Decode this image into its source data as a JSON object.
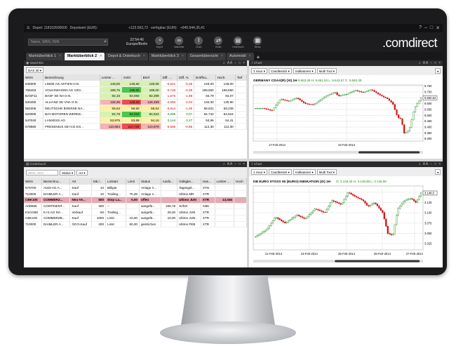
{
  "window": {
    "depot": "Depot: 118102600600",
    "depotwert_label": "Depotwert (EUR):",
    "depotwert": "+123.563,72",
    "verfuegbar_label": "verfügbar (EUR):",
    "verfuegbar": "+949.944,35,41"
  },
  "toolbar": {
    "search_placeholder": "Name, WKN, ISIN",
    "clock": "22:54:46",
    "clock_sub": "Europe/Berlin",
    "buttons": [
      "Depot",
      "Watchlist",
      "Chart",
      "Order",
      "Orderbuch",
      "News"
    ],
    "logo_prefix": ".com",
    "logo_suffix": "direct"
  },
  "tabs": [
    {
      "label": "Marktüberblick 1"
    },
    {
      "label": "Marktüberblick 2"
    },
    {
      "label": "Depot & Orderbuch"
    },
    {
      "label": "Marktüberblick 3"
    },
    {
      "label": "Gesamtübersicht"
    },
    {
      "label": "Automobil"
    }
  ],
  "watchlist": {
    "panel_title": "Watchlist",
    "index_select": "DAX 30",
    "columns": [
      "WKN",
      "Bezeichnung",
      "Letzter ...",
      "Geld",
      "Brief",
      "Diff. ...",
      "Diff. %",
      "Eröffnu...",
      "Hoch",
      "Tief"
    ],
    "rows": [
      [
        "648300",
        "LINDE AG AKTIEN O.N.",
        "149,00",
        "148,50",
        "149,05",
        "-0,521",
        "-0,35",
        "149,00",
        "149,00",
        ""
      ],
      [
        "766403",
        "VOLKSWAGEN AG VZO...",
        "188,75",
        "188,50",
        "189,00",
        "-0,749",
        "-0,39",
        "189,650",
        "189,650",
        ""
      ],
      [
        "BASF11",
        "BASF SE NA O.N.",
        "82,15",
        "82,083",
        "82,299",
        "-1,575",
        "-1,88",
        "83,79",
        "84,07",
        ""
      ],
      [
        "840400",
        "ALLIANZ SE VNA O.N.",
        "128,35",
        "128,20",
        "128,499",
        "-2,660",
        "-2,04",
        "130,30",
        "130,90",
        ""
      ],
      [
        "581005",
        "DEUTSCHE BOERSE NA...",
        "58,63",
        "58,50",
        "58,64",
        "-0,814",
        "-1,35",
        "58,631",
        "59,239",
        ""
      ],
      [
        "520000",
        "BAY.MOTOREN WERKE...",
        "84,78",
        "84,253",
        "84,523",
        "0,059",
        "0,07",
        "84,732",
        "84,924",
        ""
      ],
      [
        "547040",
        "LANXESS AG",
        "53,975",
        "53,89",
        "54,16",
        "0,144",
        "0,27",
        "53,95",
        "54,41",
        ""
      ],
      [
        "578560",
        "FRESENIUS SE+CO.KG...",
        "110,854",
        "110,729",
        "110,978",
        "-0,665",
        "-0,86",
        "112,30",
        "112,30",
        ""
      ]
    ]
  },
  "chart1": {
    "panel_title": "Chart",
    "interval": "1 Hour",
    "style": "Candlestick",
    "indicators": "Indikatoren",
    "tool": "Multi Tool",
    "title": "GERMANY CDAX(R) (XI)",
    "tf": "1H",
    "ohlc": "9.653,36 H: 9.661,53 L: 9.643,67 C: 9.650,38",
    "yticks": [
      "9.750",
      "9.700",
      "9.650",
      "9.600",
      "9.550",
      "9.500",
      "9.450",
      "9.400",
      "9.350",
      "9.300"
    ],
    "xticks": [
      "17-Feb-2014",
      "24-Feb-2014"
    ],
    "last": "9.650,52",
    "ylim": [
      9280,
      9760
    ]
  },
  "orderbook": {
    "panel_title": "Orderbuch",
    "search_placeholder": "WKN, ISIN",
    "filter1": "Status",
    "filter2": "Art",
    "columns": [
      "WKN",
      "Bezeichnu...",
      "Art",
      "Stk./...",
      "Limitart",
      "Limit",
      "Status",
      "Ausfü...",
      "Gültigke...",
      "Han...",
      "Letzter ...",
      "Hoch"
    ],
    "rows": [
      [
        "675700",
        "AUDI AG A...",
        "Kauf",
        "10",
        "Billigst",
        "",
        "Anlage n...",
        "",
        "Tagesgül...",
        "STG",
        "",
        ""
      ],
      [
        "710000",
        "DAIMLER A...",
        "Kauf",
        "10",
        "Trailing...",
        "70,48",
        "Anlage n...",
        "",
        "Ultimo MR",
        "XTR",
        "",
        ""
      ],
      [
        "CBK100",
        "COMMERZ...",
        "Neu-Ve...",
        "500",
        "Stop La...",
        "0,00",
        "offen",
        "",
        "Ultimo JUN",
        "XTR",
        "13,045",
        ""
      ],
      [
        "A0D655",
        "CONTINENT...",
        "Kauf",
        "300",
        "--",
        "",
        "ausgefü...",
        "166,78",
        "Sofort",
        "CBK",
        "",
        ""
      ],
      [
        "KSAG88",
        "K+S AG NA...",
        "Verkauf",
        "50",
        "Trailing...",
        "",
        "ausgefü...",
        "25,00",
        "Ultimo JUN",
        "XTR",
        "",
        ""
      ],
      [
        "CBK100",
        "COMMERZB...",
        "Kauf",
        "1000",
        "Limit",
        "10,00",
        "ausgefü...",
        "10,00",
        "Ultimo JUN",
        "XTR",
        "",
        ""
      ],
      [
        "710000",
        "DAIMLER A...",
        "OCO-Kauf",
        "200",
        "Limit",
        "60,00",
        "gestrichen",
        "",
        "Ultimo FEB",
        "XTR",
        "",
        ""
      ]
    ]
  },
  "chart2": {
    "panel_title": "Chart",
    "interval": "1 Hour",
    "style": "Candlestick",
    "indicators": "Indikatoren",
    "tool": "Multi Tool",
    "title": "DB EURO STOXX 50 (EURO) INDIKATION (IX)",
    "tf": "1H",
    "ohlc": "O: 3.146,48 H: 3.149,98 L: 3.146,08",
    "yticks": [
      "3.150",
      "3.125",
      "3.100",
      "3.075",
      "3.050",
      "3.025"
    ],
    "xticks": [
      "21-Feb-2014",
      "24-Feb-2014",
      "25-Feb-2014",
      "26-Feb-2014",
      "27-Feb-2014"
    ],
    "last": "3.148,5",
    "ylim": [
      3010,
      3165
    ]
  },
  "colors": {
    "frame": "#1b1b1d",
    "logo_dot": "#f7a800",
    "green": "#1a8b1a",
    "red": "#cc1111"
  }
}
